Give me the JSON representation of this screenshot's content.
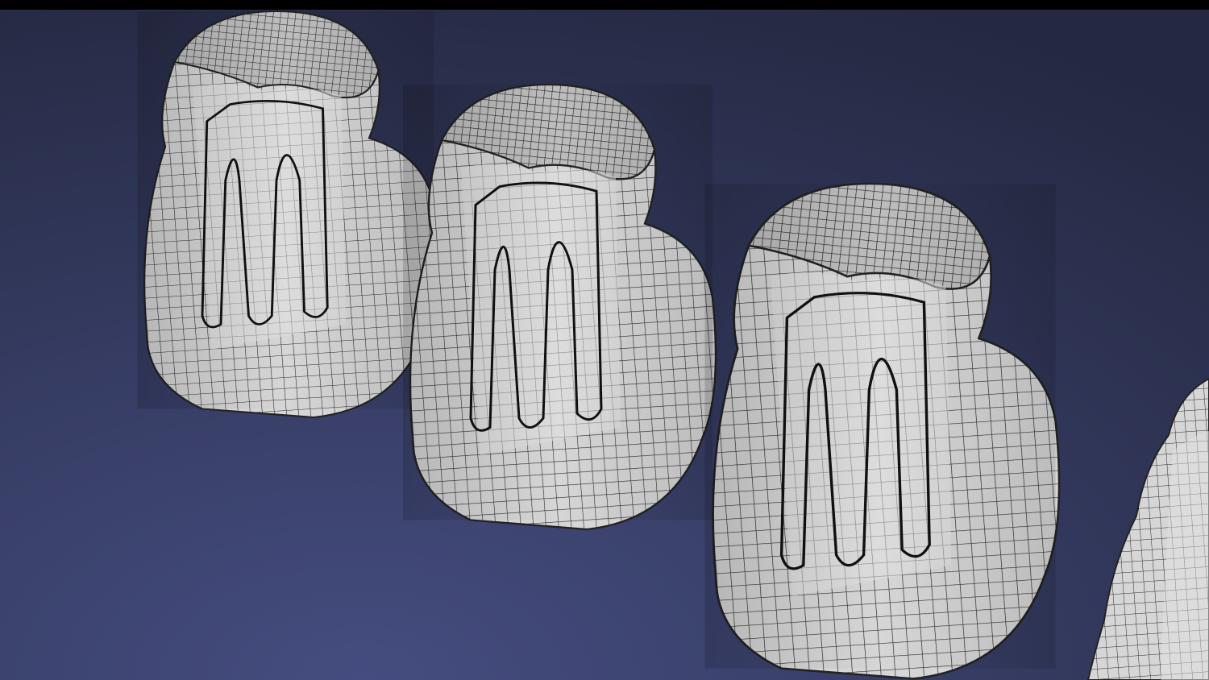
{
  "scene": {
    "subject": "tooth-cross-section-wireframes",
    "tooth_count": 4,
    "colors": {
      "background_top": "#262a42",
      "background_bottom": "#424a7a",
      "mesh_fill": "#d9d9d9",
      "mesh_line": "#1e1e1e",
      "top_bar": "#000000"
    }
  }
}
